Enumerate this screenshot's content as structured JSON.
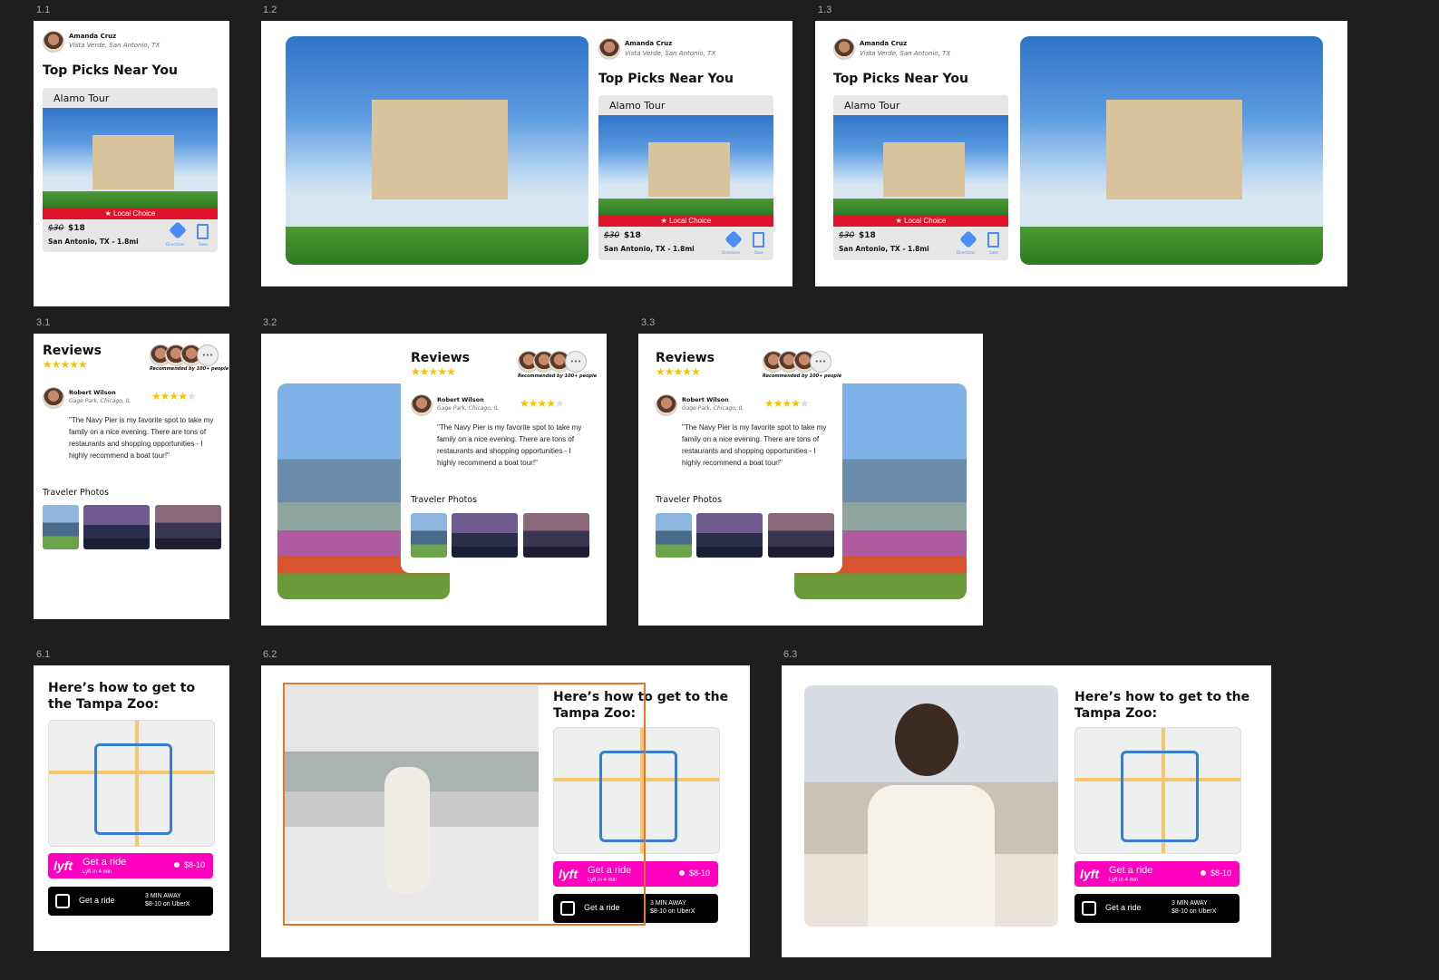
{
  "frame_labels": {
    "f11": "1.1",
    "f12": "1.2",
    "f13": "1.3",
    "f31": "3.1",
    "f32": "3.2",
    "f33": "3.3",
    "f61": "6.1",
    "f62": "6.2",
    "f63": "6.3"
  },
  "user": {
    "name": "Amanda Cruz",
    "location": "Vista Verde, San Antonio, TX"
  },
  "picks": {
    "heading": "Top Picks Near You",
    "card_title": "Alamo Tour",
    "badge": "★ Local Choice",
    "old_price": "$30",
    "price": "$18",
    "place": "San Antonio, TX - 1.8mi",
    "directions_label": "Directions",
    "save_label": "Save"
  },
  "reviews": {
    "heading": "Reviews",
    "rating_stars": "★★★★★",
    "recommended": "Recommended by 100+ people",
    "more": "•••",
    "reviewer_name": "Robert Wilson",
    "reviewer_location": "Gage Park, Chicago, IL",
    "reviewer_stars": "★★★★",
    "reviewer_empty_star": "★",
    "quote": "\"The Navy Pier is my favorite spot to take my family on a nice evening. There are tons of restaurants and shopping opportunities - I highly recommend a boat tour!\"",
    "photos_heading": "Traveler Photos"
  },
  "rides": {
    "heading": "Here’s how to get to the Tampa Zoo:",
    "lyft_logo": "lyft",
    "lyft_cta": "Get a ride",
    "lyft_sub": "Lyft in 4 min",
    "lyft_price": "$8-10",
    "uber_cta": "Get a ride",
    "uber_eta": "3 MIN AWAY",
    "uber_price": "$8-10 on UberX"
  },
  "colors": {
    "canvas": "#1e1e1e",
    "badge_red": "#e0132d",
    "lyft_pink": "#ff00bf",
    "star_yellow": "#f5c400",
    "icon_blue": "#4a8df6",
    "selection": "#e8732a"
  }
}
